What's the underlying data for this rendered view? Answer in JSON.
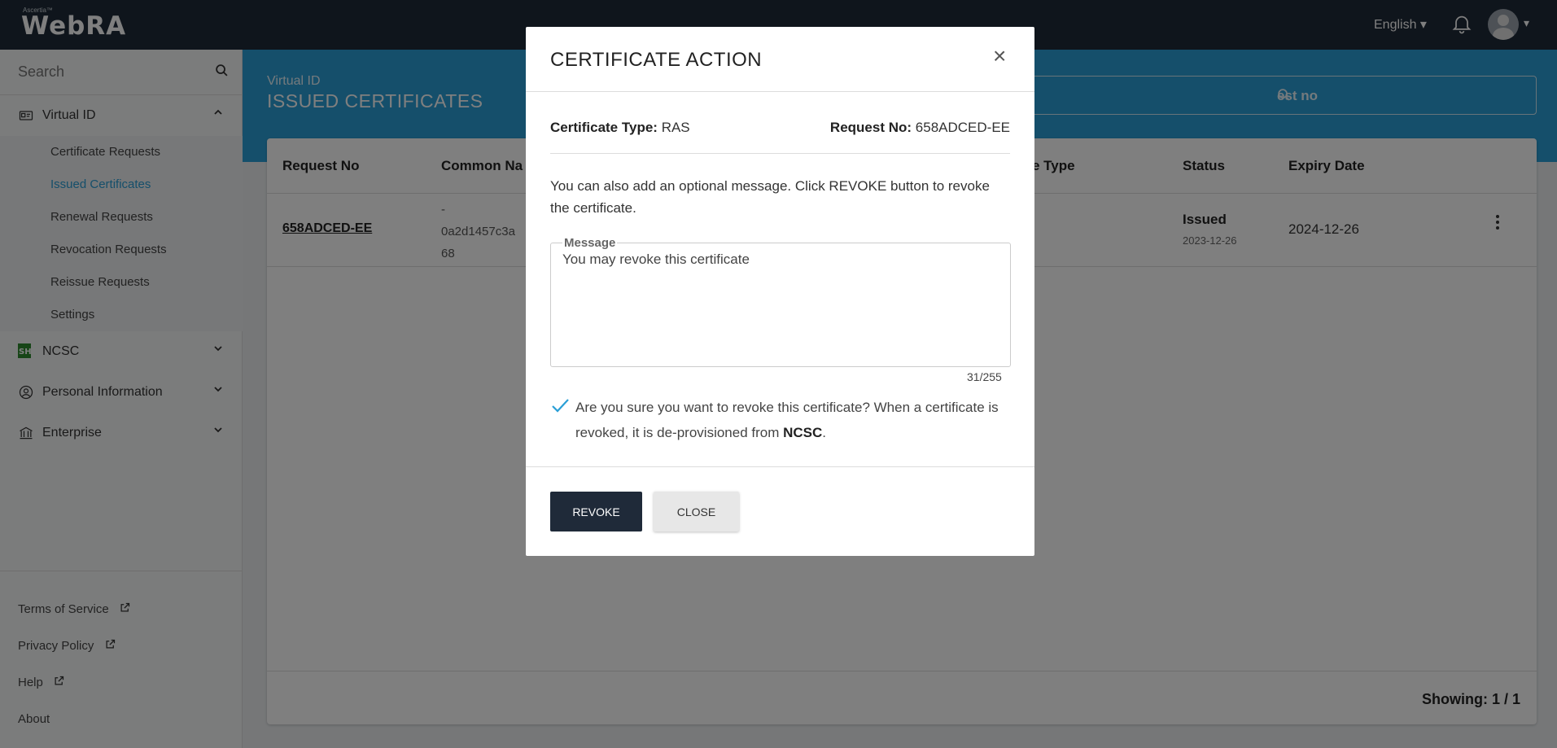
{
  "app": {
    "logo_small": "Ascertia™",
    "logo_big": "WebRA",
    "language": "English ▾",
    "avatar_caret": "▾"
  },
  "sidebar": {
    "search_placeholder": "Search",
    "groups": [
      {
        "label": "Virtual ID",
        "expanded": true,
        "items": [
          {
            "label": "Certificate Requests"
          },
          {
            "label": "Issued Certificates"
          },
          {
            "label": "Renewal Requests"
          },
          {
            "label": "Revocation Requests"
          },
          {
            "label": "Reissue Requests"
          },
          {
            "label": "Settings"
          }
        ]
      },
      {
        "label": "NCSC"
      },
      {
        "label": "Personal Information"
      },
      {
        "label": "Enterprise"
      }
    ],
    "footer": [
      {
        "label": "Terms of Service"
      },
      {
        "label": "Privacy Policy"
      },
      {
        "label": "Help"
      },
      {
        "label": "About"
      }
    ]
  },
  "banner": {
    "subtitle": "Virtual ID",
    "title": "ISSUED CERTIFICATES",
    "search_visible": "est no"
  },
  "table": {
    "headers": [
      "Request No",
      "Common Na",
      "e Type",
      "Status",
      "Expiry Date"
    ],
    "rows": [
      {
        "request_no": "658ADCED-EE",
        "cn_line1": "-",
        "cn_line2": "0a2d1457c3a",
        "cn_line3": "68",
        "status": "Issued",
        "status_date": "2023-12-26",
        "expiry": "2024-12-26"
      }
    ],
    "showing": "Showing:  1 / 1"
  },
  "modal": {
    "title": "CERTIFICATE ACTION",
    "close": "×",
    "cert_type_label": "Certificate Type:",
    "cert_type_value": "RAS",
    "request_no_label": "Request No:",
    "request_no_value": "658ADCED-EE",
    "description": "You can also add an optional message. Click REVOKE button to revoke the certificate.",
    "message_label": "Message",
    "message_value": "You may revoke this certificate",
    "counter": "31/255",
    "confirm_text_1": "Are you sure you want to revoke this certificate? When a certificate is revoked, it is de-provisioned from ",
    "confirm_bold": "NCSC",
    "confirm_text_2": ".",
    "confirm_checked": true,
    "revoke_label": "REVOKE",
    "close_label": "CLOSE"
  },
  "colors": {
    "topbar": "#1f2a39",
    "accent": "#2a9fd6",
    "revoke_btn": "#1f2a39"
  }
}
